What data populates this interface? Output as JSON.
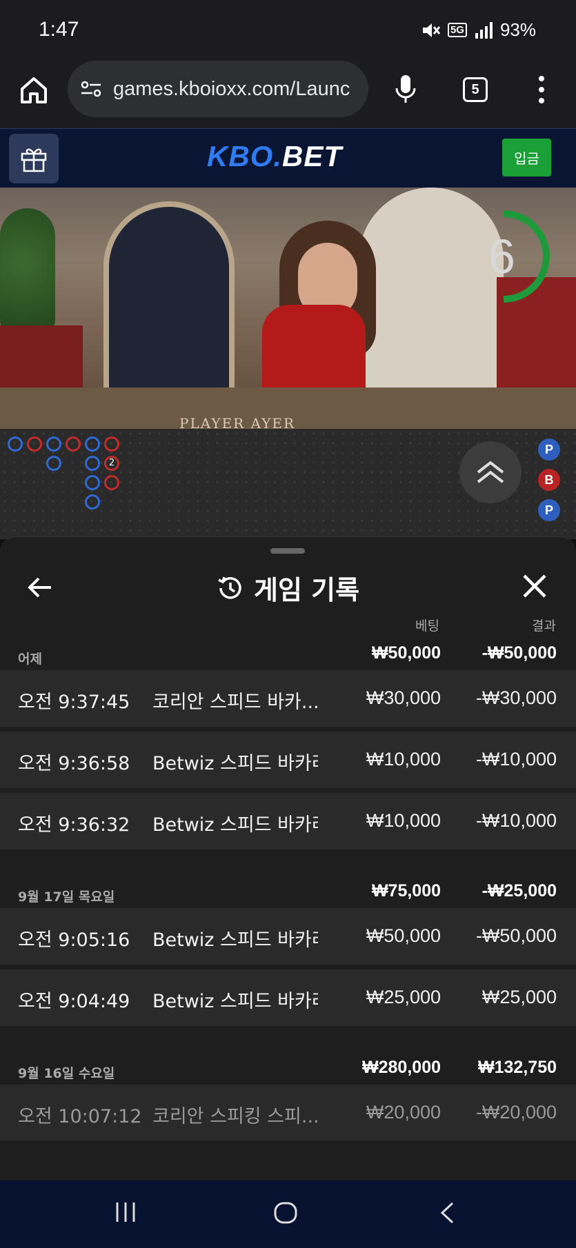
{
  "status_bar": {
    "time": "1:47",
    "battery": "93%",
    "network": "5G"
  },
  "browser": {
    "url": "games.kboioxx.com/Launc",
    "tab_count": "5"
  },
  "site": {
    "logo_kbo": "KBO.",
    "logo_bet": "BET",
    "deposit_label": "입금"
  },
  "video": {
    "timer_value": "6",
    "table_text": "PLAYER          AYER"
  },
  "roadmap": {
    "side_badges": [
      "P",
      "B",
      "P"
    ],
    "tie_count": "2"
  },
  "sheet": {
    "title": "게임 기록",
    "col_bet": "베팅",
    "col_result": "결과",
    "groups": [
      {
        "date": "어제",
        "bet_total": "₩50,000",
        "result_total": "-₩50,000",
        "rows": [
          {
            "time": "오전 9:37:45",
            "game": "코리안 스피드 바카...",
            "bet": "₩30,000",
            "result": "-₩30,000"
          },
          {
            "time": "오전 9:36:58",
            "game": "Betwiz 스피드 바카라",
            "bet": "₩10,000",
            "result": "-₩10,000"
          },
          {
            "time": "오전 9:36:32",
            "game": "Betwiz 스피드 바카라",
            "bet": "₩10,000",
            "result": "-₩10,000"
          }
        ]
      },
      {
        "date": "9월 17일 목요일",
        "bet_total": "₩75,000",
        "result_total": "-₩25,000",
        "rows": [
          {
            "time": "오전 9:05:16",
            "game": "Betwiz 스피드 바카라",
            "bet": "₩50,000",
            "result": "-₩50,000"
          },
          {
            "time": "오전 9:04:49",
            "game": "Betwiz 스피드 바카라",
            "bet": "₩25,000",
            "result": "₩25,000"
          }
        ]
      },
      {
        "date": "9월 16일 수요일",
        "bet_total": "₩280,000",
        "result_total": "₩132,750",
        "rows": [
          {
            "time": "오전 10:07:12",
            "game": "코리안 스피킹 스피...",
            "bet": "₩20,000",
            "result": "-₩20,000"
          }
        ]
      }
    ]
  },
  "colors": {
    "accent_blue": "#2f7bf2",
    "deposit_green": "#1aa037",
    "header_navy": "#0a1433",
    "timer_green": "#1f9a3a"
  }
}
